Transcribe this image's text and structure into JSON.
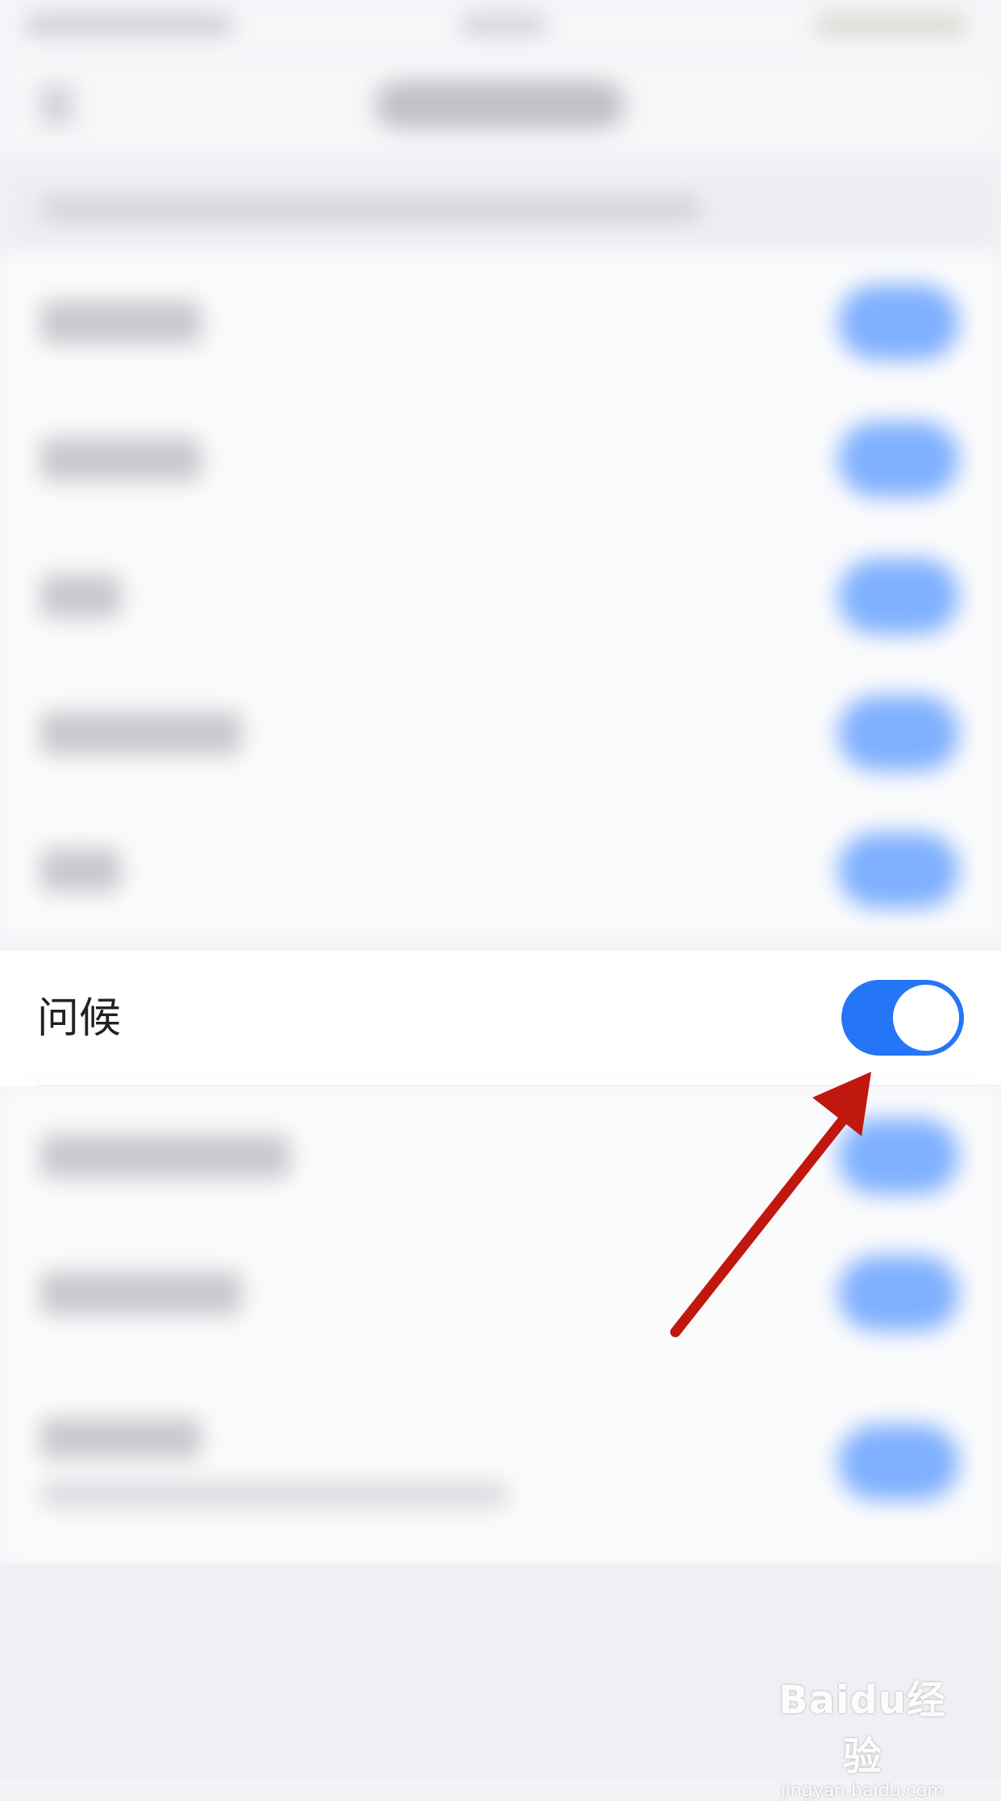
{
  "focused_row": {
    "label": "问候",
    "toggle_on": true
  },
  "colors": {
    "toggle_on": "#2576f7",
    "annotation_arrow": "#c0170f"
  },
  "watermark": {
    "logo": "Baidu经验",
    "url": "jingyan.baidu.com"
  }
}
